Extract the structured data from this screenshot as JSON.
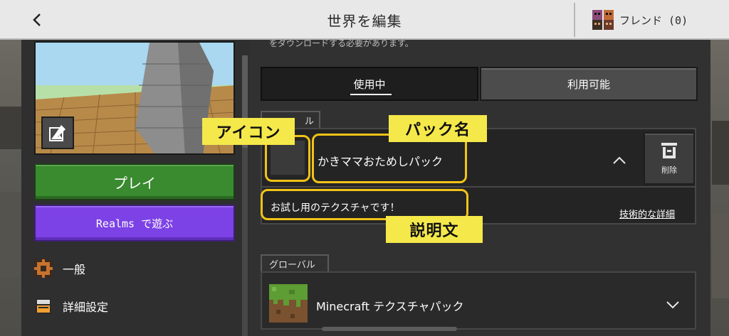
{
  "header": {
    "title": "世界を編集",
    "friends_label": "フレンド (0)"
  },
  "left": {
    "play_label": "プレイ",
    "realms_label": "Realms で遊ぶ",
    "menu": {
      "general": "一般",
      "advanced": "詳細設定"
    }
  },
  "main": {
    "scroll_hint": "をダウンロードする必要があります。",
    "tabs": {
      "active": "使用中",
      "available": "利用可能"
    },
    "local_section_label": "ル",
    "local_pack": {
      "name": "かきママおためしパック",
      "description": "お試し用のテクスチャです！",
      "delete_label": "削除",
      "details_link": "技術的な詳細"
    },
    "global_section_label": "グローバル",
    "global_pack": {
      "name": "Minecraft テクスチャパック"
    }
  },
  "annotations": {
    "icon_label": "アイコン",
    "pack_name_label": "パック名",
    "description_label": "説明文"
  },
  "colors": {
    "play_green": "#3a8a30",
    "realms_purple": "#7d42e6",
    "annotation_yellow": "#f5e84a",
    "annotation_border": "#f2c318"
  }
}
